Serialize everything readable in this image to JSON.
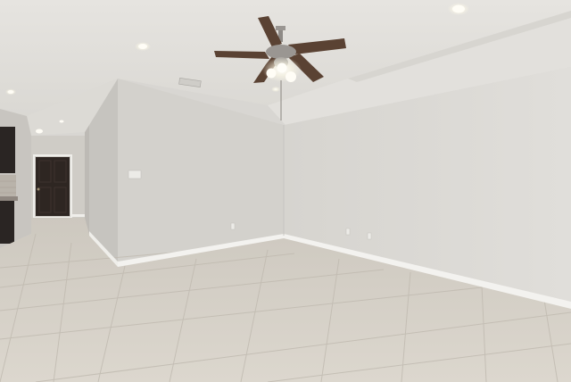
{
  "scene": {
    "subject": "empty-living-room",
    "palette": {
      "ceiling": "#e4e2de",
      "ceiling_shadow": "#d3d1cc",
      "wall_right": "#dcdad6",
      "wall_center": "#d2d0cb",
      "wall_left_hall": "#c9c7c2",
      "floor": "#d6d1c8",
      "floor_far": "#cdc7bd",
      "grout": "#bfb9af",
      "baseboard": "#f4f3f0",
      "door": "#2e2622",
      "cabinet": "#2a2523",
      "fan_blade": "#5a4233",
      "fan_metal": "#9a9692",
      "light_glow": "#fffdf6"
    }
  }
}
